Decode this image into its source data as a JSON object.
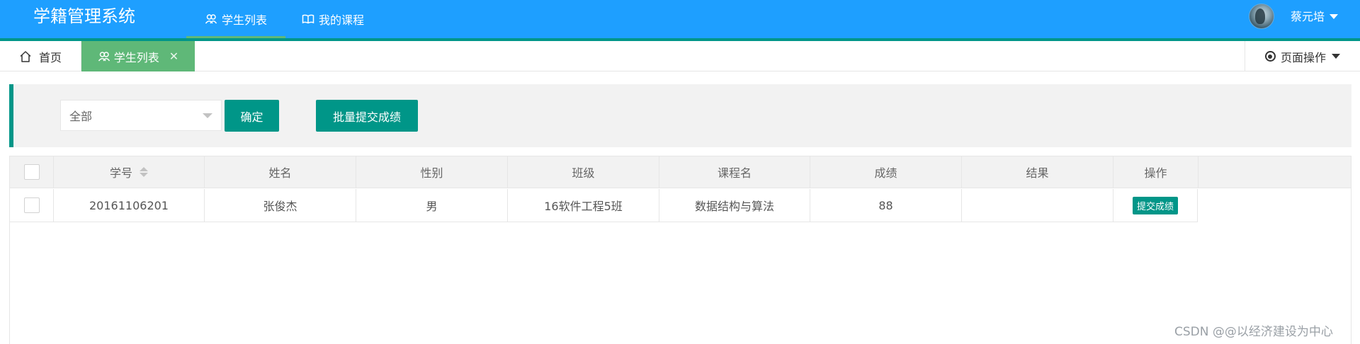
{
  "header": {
    "logo": "学籍管理系统",
    "nav": [
      {
        "label": "学生列表",
        "icon": "users-icon"
      },
      {
        "label": "我的课程",
        "icon": "book-icon"
      }
    ],
    "user_name": "蔡元培",
    "colors": {
      "bar": "#1E9FFF",
      "accent": "#009688",
      "active": "#5FB878"
    }
  },
  "tabs": {
    "home": {
      "label": "首页",
      "icon": "home-icon"
    },
    "active": {
      "label": "学生列表",
      "icon": "users-icon",
      "close_icon": "close-icon"
    },
    "page_ops": "页面操作"
  },
  "toolbar": {
    "select_value": "全部",
    "confirm_label": "确定",
    "batch_label": "批量提交成绩"
  },
  "table": {
    "columns": [
      "学号",
      "姓名",
      "性别",
      "班级",
      "课程名",
      "成绩",
      "结果",
      "操作"
    ],
    "rows": [
      {
        "id": "20161106201",
        "name": "张俊杰",
        "gender": "男",
        "class": "16软件工程5班",
        "course": "数据结构与算法",
        "score": "88",
        "result": "",
        "action": "提交成绩"
      }
    ]
  },
  "watermark": "CSDN @@以经济建设为中心"
}
